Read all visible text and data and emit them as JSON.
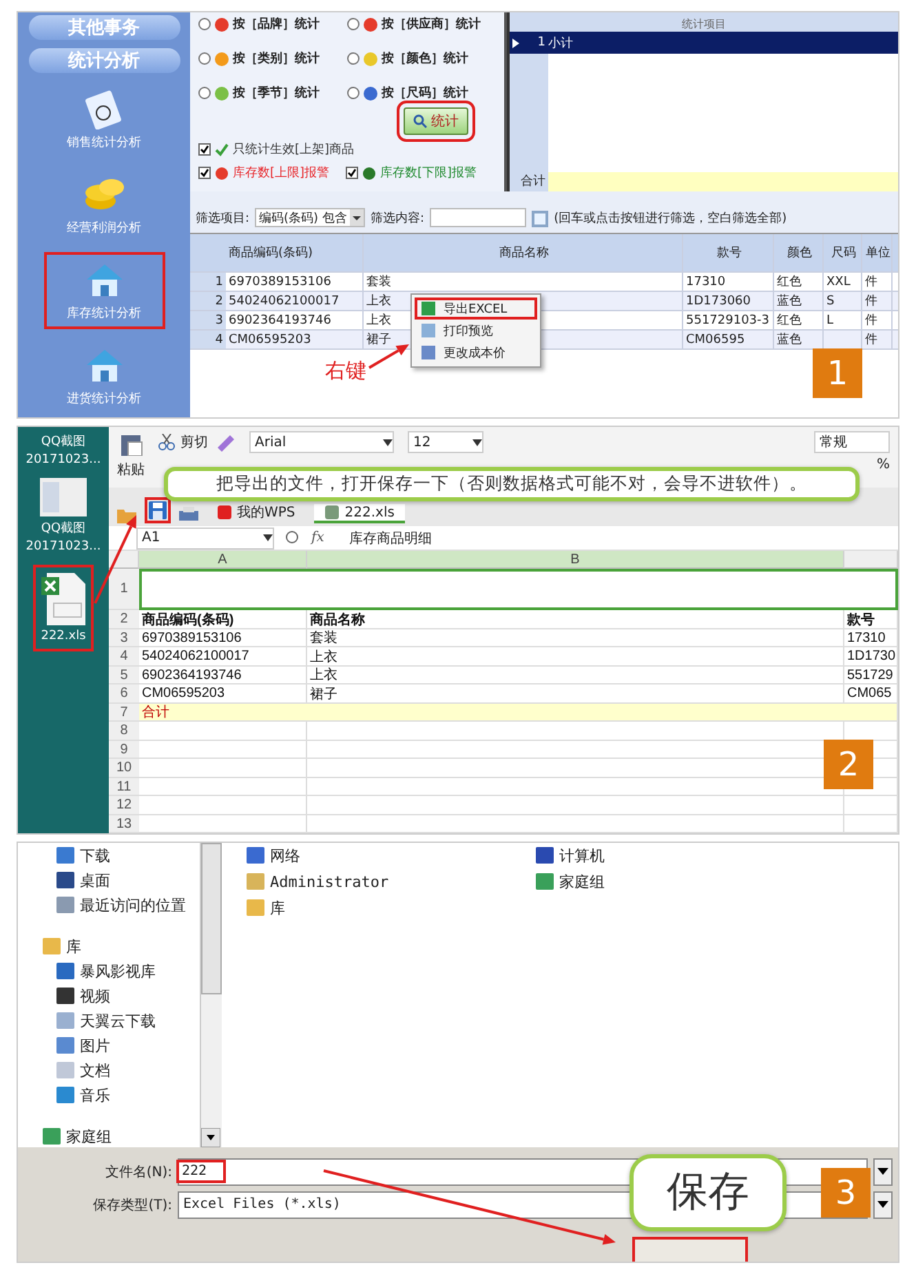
{
  "step1": {
    "sidebar": {
      "buttons": [
        "其他事务",
        "统计分析"
      ],
      "items": [
        {
          "label": "销售统计分析",
          "selected": false
        },
        {
          "label": "经营利润分析",
          "selected": false
        },
        {
          "label": "库存统计分析",
          "selected": true
        },
        {
          "label": "进货统计分析",
          "selected": false
        }
      ]
    },
    "group_options": [
      {
        "label": "按［品牌］统计",
        "selected": false
      },
      {
        "label": "按［供应商］统计",
        "selected": false
      },
      {
        "label": "按［类别］统计",
        "selected": false
      },
      {
        "label": "按［颜色］统计",
        "selected": false
      },
      {
        "label": "按［季节］统计",
        "selected": false
      },
      {
        "label": "按［尺码］统计",
        "selected": false
      }
    ],
    "stat_button": "统计",
    "checks": [
      {
        "label": "只统计生效[上架]商品",
        "checked": true,
        "color": "#333333"
      },
      {
        "label": "库存数[上限]报警",
        "checked": true,
        "color": "#e8262a"
      },
      {
        "label": "库存数[下限]报警",
        "checked": true,
        "color": "#1f8a2e"
      }
    ],
    "summary": {
      "column": "统计项目",
      "rows": [
        {
          "index": "1",
          "label": "小计",
          "selected": true
        }
      ],
      "total_label": "合计"
    },
    "filter": {
      "label": "筛选项目:",
      "field_value": "编码(条码) 包含",
      "content_label": "筛选内容:",
      "hint": "(回车或点击按钮进行筛选，空白筛选全部)"
    },
    "table": {
      "columns": [
        "商品编码(条码)",
        "商品名称",
        "款号",
        "颜色",
        "尺码",
        "单位"
      ],
      "rows": [
        {
          "index": "1",
          "cells": [
            "6970389153106",
            "套装",
            "17310",
            "红色",
            "XXL",
            "件"
          ]
        },
        {
          "index": "2",
          "cells": [
            "54024062100017",
            "上衣",
            "1D173060",
            "蓝色",
            "S",
            "件"
          ]
        },
        {
          "index": "3",
          "cells": [
            "6902364193746",
            "上衣",
            "551729103-3",
            "红色",
            "L",
            "件"
          ]
        },
        {
          "index": "4",
          "cells": [
            "CM06595203",
            "裙子",
            "CM06595",
            "蓝色",
            null,
            "件"
          ]
        }
      ]
    },
    "context_menu": [
      {
        "label": "导出EXCEL",
        "selected": true
      },
      {
        "label": "打印预览",
        "selected": false
      },
      {
        "label": "更改成本价",
        "selected": false
      }
    ],
    "annotation": "右键",
    "step_badge": "1"
  },
  "step2": {
    "desktop_icons": [
      {
        "name": "QQ截图",
        "caption": "20171023..."
      },
      {
        "name": "QQ截图",
        "caption": "20171023..."
      }
    ],
    "file_icon": {
      "label": "222.xls",
      "selected": true
    },
    "ribbon": {
      "paste": "粘贴",
      "cut": "剪切",
      "font": "Arial",
      "size": "12",
      "number_format": "常规",
      "percent": "%"
    },
    "tabs": [
      {
        "label": "我的WPS",
        "selected": false
      },
      {
        "label": "222.xls",
        "selected": true
      }
    ],
    "cell_ref": "A1",
    "fx_label": "fx",
    "formula": "库存商品明细",
    "column_headers": [
      "A",
      "B"
    ],
    "rows": [
      {
        "number": "1",
        "kind": "title"
      },
      {
        "number": "2",
        "kind": "header",
        "cells": [
          "商品编码(条码)",
          "商品名称",
          "款号"
        ]
      },
      {
        "number": "3",
        "kind": "data",
        "cells": [
          "6970389153106",
          "套装",
          "17310"
        ]
      },
      {
        "number": "4",
        "kind": "data",
        "cells": [
          "54024062100017",
          "上衣",
          "1D1730"
        ]
      },
      {
        "number": "5",
        "kind": "data",
        "cells": [
          "6902364193746",
          "上衣",
          "551729"
        ]
      },
      {
        "number": "6",
        "kind": "data",
        "cells": [
          "CM06595203",
          "裙子",
          "CM065"
        ]
      },
      {
        "number": "7",
        "kind": "total",
        "cells": [
          "合计"
        ]
      },
      {
        "number": "8",
        "kind": "empty"
      },
      {
        "number": "9",
        "kind": "empty"
      },
      {
        "number": "10",
        "kind": "empty"
      },
      {
        "number": "11",
        "kind": "empty"
      },
      {
        "number": "12",
        "kind": "empty"
      },
      {
        "number": "13",
        "kind": "empty"
      }
    ],
    "callout": "把导出的文件，打开保存一下（否则数据格式可能不对，会导不进软件）。",
    "step_badge": "2"
  },
  "step3": {
    "favorites": [
      "下载",
      "桌面",
      "最近访问的位置"
    ],
    "tree": [
      {
        "label": "库",
        "children": [
          {
            "label": "暴风影视库"
          },
          {
            "label": "视频"
          },
          {
            "label": "天翼云下载"
          },
          {
            "label": "图片"
          },
          {
            "label": "文档"
          },
          {
            "label": "音乐"
          }
        ]
      },
      {
        "label": "家庭组"
      }
    ],
    "places": [
      "网络",
      "计算机",
      "Administrator",
      "家庭组",
      "库"
    ],
    "file_name_label": "文件名(N):",
    "file_name": "222",
    "file_type_label": "保存类型(T):",
    "file_type": "Excel Files (*.xls)",
    "callout": "保存",
    "step_badge": "3"
  }
}
